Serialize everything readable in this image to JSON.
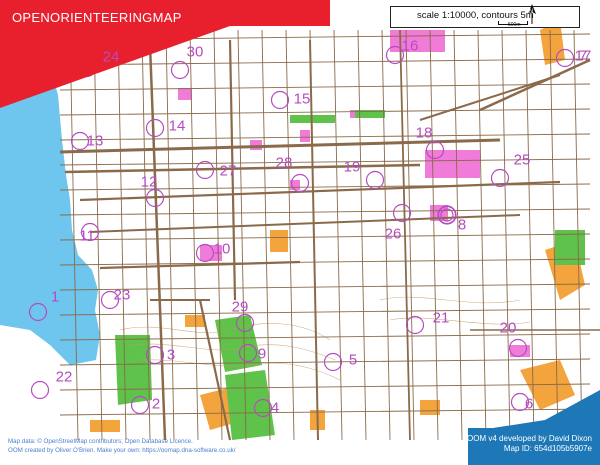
{
  "header": {
    "title": "OPENORIENTEERINGMAP",
    "scale_text": "scale 1:10000, contours 5m",
    "scale_bar_label": "500m",
    "north_label": "N"
  },
  "footer": {
    "data_credit": "Map data: © OpenStreetMap contributors; Open Database Licence.",
    "creator_credit": "OOM created by Oliver O'Brien. Make your own: https://oomap.dna-software.co.uk/",
    "developer_credit": "OOM v4 developed by David Dixon",
    "map_id": "Map ID: 654d105b5907e"
  },
  "colors": {
    "banner_red": "#e8202e",
    "banner_blue": "#1e78b8",
    "water": "#6ec5ee",
    "pink_area": "#f07bd8",
    "orange_area": "#f4a43c",
    "green_area": "#5fc24a",
    "road": "#8a6a4a",
    "control": "#b44cc0"
  },
  "controls": [
    {
      "number": "1"
    },
    {
      "number": "2"
    },
    {
      "number": "3"
    },
    {
      "number": "4"
    },
    {
      "number": "5"
    },
    {
      "number": "6"
    },
    {
      "number": "7"
    },
    {
      "number": "8"
    },
    {
      "number": "9"
    },
    {
      "number": "10"
    },
    {
      "number": "11"
    },
    {
      "number": "12"
    },
    {
      "number": "13"
    },
    {
      "number": "14"
    },
    {
      "number": "15"
    },
    {
      "number": "16"
    },
    {
      "number": "17"
    },
    {
      "number": "18"
    },
    {
      "number": "19"
    },
    {
      "number": "20"
    },
    {
      "number": "21"
    },
    {
      "number": "22"
    },
    {
      "number": "23"
    },
    {
      "number": "24"
    },
    {
      "number": "25"
    },
    {
      "number": "26"
    },
    {
      "number": "27"
    },
    {
      "number": "28"
    },
    {
      "number": "29"
    },
    {
      "number": "30"
    }
  ]
}
